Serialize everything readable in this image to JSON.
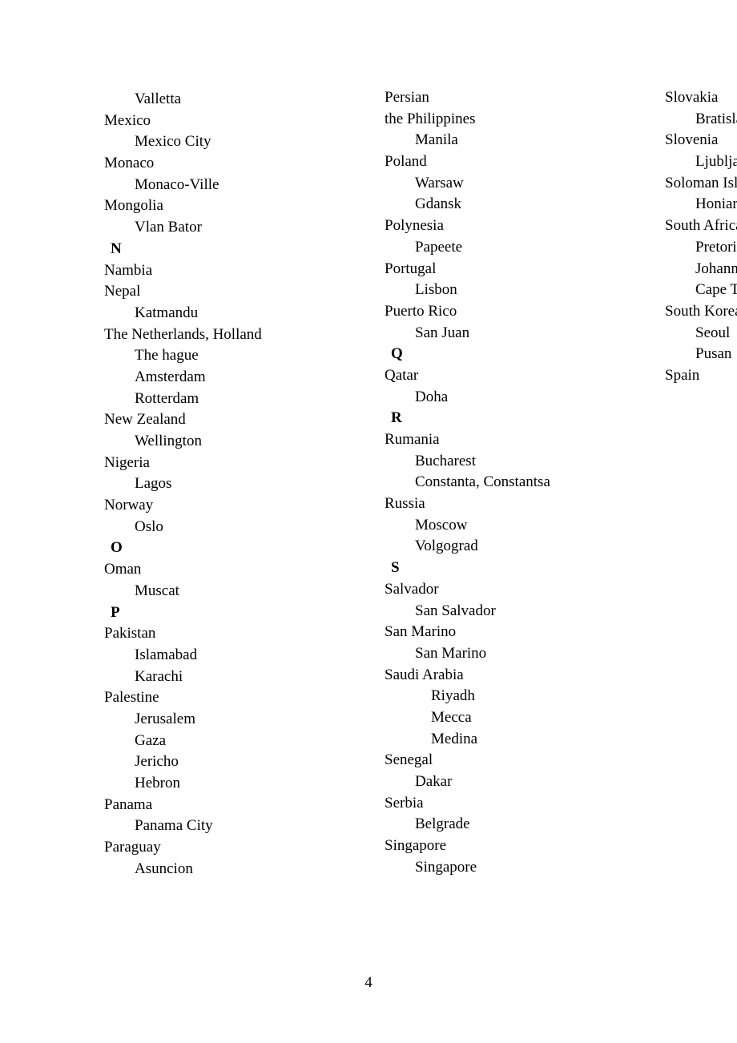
{
  "page_number": "4",
  "entries": [
    {
      "type": "city",
      "text": "Valletta"
    },
    {
      "type": "country",
      "text": "Mexico"
    },
    {
      "type": "city",
      "text": "Mexico City"
    },
    {
      "type": "country",
      "text": "Monaco"
    },
    {
      "type": "city",
      "text": "Monaco-Ville"
    },
    {
      "type": "country",
      "text": "Mongolia"
    },
    {
      "type": "city",
      "text": "Vlan Bator"
    },
    {
      "type": "header",
      "text": "N"
    },
    {
      "type": "country",
      "text": "Nambia"
    },
    {
      "type": "country",
      "text": "Nepal"
    },
    {
      "type": "city",
      "text": "Katmandu"
    },
    {
      "type": "country",
      "text": "The Netherlands, Holland"
    },
    {
      "type": "city",
      "text": "The hague"
    },
    {
      "type": "city",
      "text": "Amsterdam"
    },
    {
      "type": "city",
      "text": "Rotterdam"
    },
    {
      "type": "country",
      "text": "New Zealand"
    },
    {
      "type": "city",
      "text": "Wellington"
    },
    {
      "type": "country",
      "text": "Nigeria"
    },
    {
      "type": "city",
      "text": "Lagos"
    },
    {
      "type": "country",
      "text": "Norway"
    },
    {
      "type": "city",
      "text": "Oslo"
    },
    {
      "type": "header",
      "text": "O"
    },
    {
      "type": "country",
      "text": "Oman"
    },
    {
      "type": "city",
      "text": "Muscat"
    },
    {
      "type": "header",
      "text": "P"
    },
    {
      "type": "country",
      "text": "Pakistan"
    },
    {
      "type": "city",
      "text": "Islamabad"
    },
    {
      "type": "city",
      "text": "Karachi"
    },
    {
      "type": "country",
      "text": "Palestine"
    },
    {
      "type": "city",
      "text": "Jerusalem"
    },
    {
      "type": "city",
      "text": "Gaza"
    },
    {
      "type": "city",
      "text": "Jericho"
    },
    {
      "type": "city",
      "text": "Hebron"
    },
    {
      "type": "country",
      "text": "Panama"
    },
    {
      "type": "city",
      "text": "Panama City"
    },
    {
      "type": "country",
      "text": "Paraguay"
    },
    {
      "type": "city",
      "text": "Asuncion"
    },
    {
      "type": "country",
      "text": "Persian"
    },
    {
      "type": "country",
      "text": "the Philippines"
    },
    {
      "type": "city",
      "text": "Manila"
    },
    {
      "type": "country",
      "text": "Poland"
    },
    {
      "type": "city",
      "text": "Warsaw"
    },
    {
      "type": "city",
      "text": "Gdansk"
    },
    {
      "type": "country",
      "text": "Polynesia"
    },
    {
      "type": "city",
      "text": "Papeete"
    },
    {
      "type": "country",
      "text": "Portugal"
    },
    {
      "type": "city",
      "text": "Lisbon"
    },
    {
      "type": "country",
      "text": "Puerto Rico"
    },
    {
      "type": "city",
      "text": "San Juan"
    },
    {
      "type": "header",
      "text": "Q"
    },
    {
      "type": "country",
      "text": "Qatar"
    },
    {
      "type": "city",
      "text": "Doha"
    },
    {
      "type": "header",
      "text": "R"
    },
    {
      "type": "country",
      "text": "Rumania"
    },
    {
      "type": "city",
      "text": "Bucharest"
    },
    {
      "type": "city",
      "text": "Constanta, Constantsa"
    },
    {
      "type": "country",
      "text": "Russia"
    },
    {
      "type": "city",
      "text": "Moscow"
    },
    {
      "type": "city",
      "text": "Volgograd"
    },
    {
      "type": "header",
      "text": "S"
    },
    {
      "type": "country",
      "text": "Salvador"
    },
    {
      "type": "city",
      "text": "San Salvador"
    },
    {
      "type": "country",
      "text": "San Marino"
    },
    {
      "type": "city",
      "text": "San Marino"
    },
    {
      "type": "country",
      "text": "Saudi Arabia"
    },
    {
      "type": "city2",
      "text": "Riyadh"
    },
    {
      "type": "city2",
      "text": "Mecca"
    },
    {
      "type": "city2",
      "text": "Medina"
    },
    {
      "type": "country",
      "text": "Senegal"
    },
    {
      "type": "city",
      "text": "Dakar"
    },
    {
      "type": "country",
      "text": "Serbia"
    },
    {
      "type": "city",
      "text": "Belgrade"
    },
    {
      "type": "country",
      "text": "Singapore"
    },
    {
      "type": "city",
      "text": "Singapore"
    },
    {
      "type": "country",
      "text": "Slovakia"
    },
    {
      "type": "city",
      "text": "Bratislava"
    },
    {
      "type": "country",
      "text": "Slovenia"
    },
    {
      "type": "city",
      "text": "Ljubljana"
    },
    {
      "type": "country",
      "text": "Soloman Islands"
    },
    {
      "type": "city",
      "text": "Honiara"
    },
    {
      "type": "country",
      "text": "South Africa"
    },
    {
      "type": "city",
      "text": "Pretoria"
    },
    {
      "type": "city",
      "text": "Johannesburg"
    },
    {
      "type": "city",
      "text": "Cape Town"
    },
    {
      "type": "country",
      "text": "South Korea"
    },
    {
      "type": "city",
      "text": "Seoul"
    },
    {
      "type": "city",
      "text": "Pusan"
    },
    {
      "type": "country",
      "text": "Spain"
    }
  ]
}
